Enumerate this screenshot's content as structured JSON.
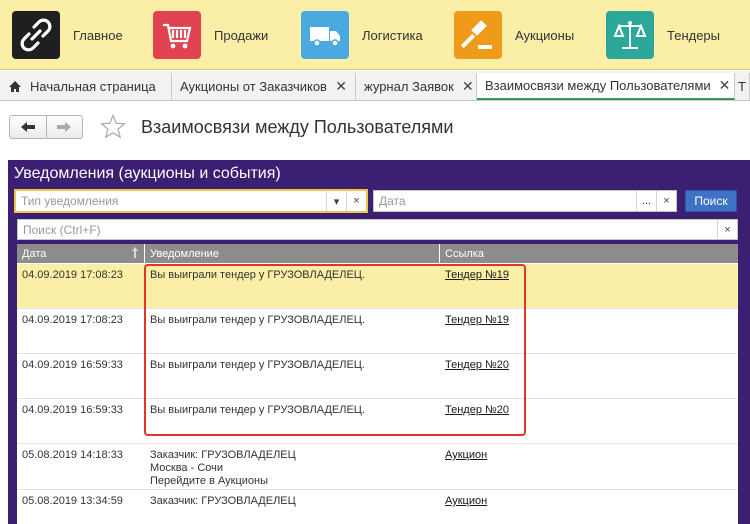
{
  "sections": [
    {
      "label": "Главное",
      "icon": "link-icon",
      "color": "#1f1f1f"
    },
    {
      "label": "Продажи",
      "icon": "cart-icon",
      "color": "#e0434f"
    },
    {
      "label": "Логистика",
      "icon": "truck-icon",
      "color": "#4aa9de"
    },
    {
      "label": "Аукционы",
      "icon": "gavel-icon",
      "color": "#f09a1a"
    },
    {
      "label": "Тендеры",
      "icon": "scales-icon",
      "color": "#2ba89a"
    }
  ],
  "tabs": [
    {
      "label": "Начальная страница",
      "closable": false
    },
    {
      "label": "Аукционы от Заказчиков",
      "closable": true
    },
    {
      "label": "журнал Заявок",
      "closable": true
    },
    {
      "label": "Взаимосвязи между Пользователями",
      "closable": true
    },
    {
      "label": "Т",
      "closable": false
    }
  ],
  "page": {
    "title": "Взаимосвязи между Пользователями"
  },
  "panel": {
    "title": "Уведомления (аукционы и события)",
    "type_placeholder": "Тип уведомления",
    "date_placeholder": "Дата",
    "search_button": "Поиск",
    "search_placeholder": "Поиск (Ctrl+F)",
    "date_picker_label": "...",
    "dropdown_arrow": "▾",
    "clear_glyph": "×"
  },
  "table": {
    "columns": [
      "Дата",
      "Уведомление",
      "Ссылка"
    ],
    "rows": [
      {
        "date": "04.09.2019 17:08:23",
        "note": [
          "Вы выиграли тендер у ГРУЗОВЛАДЕЛЕЦ."
        ],
        "link": "Тендер №19",
        "selected": true
      },
      {
        "date": "04.09.2019 17:08:23",
        "note": [
          "Вы выиграли тендер у ГРУЗОВЛАДЕЛЕЦ."
        ],
        "link": "Тендер №19",
        "selected": false
      },
      {
        "date": "04.09.2019 16:59:33",
        "note": [
          "Вы выиграли тендер у ГРУЗОВЛАДЕЛЕЦ."
        ],
        "link": "Тендер №20",
        "selected": false
      },
      {
        "date": "04.09.2019 16:59:33",
        "note": [
          "Вы выиграли тендер у ГРУЗОВЛАДЕЛЕЦ."
        ],
        "link": "Тендер №20",
        "selected": false
      },
      {
        "date": "05.08.2019 14:18:33",
        "note": [
          "Заказчик: ГРУЗОВЛАДЕЛЕЦ",
          "Москва - Сочи",
          "Перейдите в Аукционы"
        ],
        "link": "Аукцион",
        "selected": false
      },
      {
        "date": "05.08.2019 13:34:59",
        "note": [
          "Заказчик: ГРУЗОВЛАДЕЛЕЦ"
        ],
        "link": "Аукцион",
        "selected": false
      }
    ]
  }
}
